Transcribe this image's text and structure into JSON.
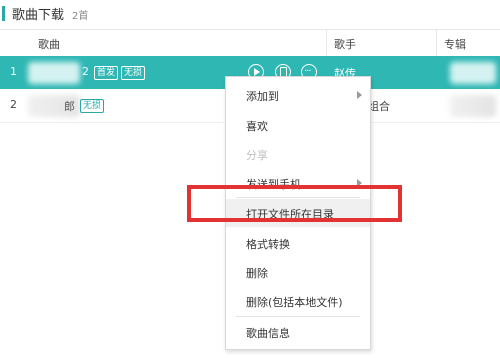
{
  "header": {
    "title": "歌曲下载",
    "count": "2首"
  },
  "columns": {
    "song": "歌曲",
    "artist": "歌手",
    "album": "专辑"
  },
  "rows": [
    {
      "num": "1",
      "song_suffix": "2",
      "tags": [
        "首发",
        "无损"
      ],
      "artist": "赵传"
    },
    {
      "num": "2",
      "song_suffix": "郎",
      "tags": [
        "无损"
      ],
      "artist": "组合"
    }
  ],
  "context_menu": {
    "items": [
      {
        "label": "添加到",
        "submenu": true,
        "disabled": false
      },
      {
        "label": "喜欢",
        "submenu": false,
        "disabled": false
      },
      {
        "label": "分享",
        "submenu": false,
        "disabled": true
      },
      {
        "label": "发送到手机",
        "submenu": true,
        "disabled": false
      },
      {
        "label": "打开文件所在目录",
        "submenu": false,
        "disabled": false,
        "highlighted": true
      },
      {
        "label": "格式转换",
        "submenu": false,
        "disabled": false
      },
      {
        "label": "删除",
        "submenu": false,
        "disabled": false
      },
      {
        "label": "删除(包括本地文件)",
        "submenu": false,
        "disabled": false
      },
      {
        "label": "歌曲信息",
        "submenu": false,
        "disabled": false
      }
    ]
  },
  "colors": {
    "accent": "#2fb7b4",
    "highlight_border": "#e23232"
  },
  "icons": [
    "play-icon",
    "phone-icon",
    "more-icon",
    "submenu-arrow-icon"
  ]
}
